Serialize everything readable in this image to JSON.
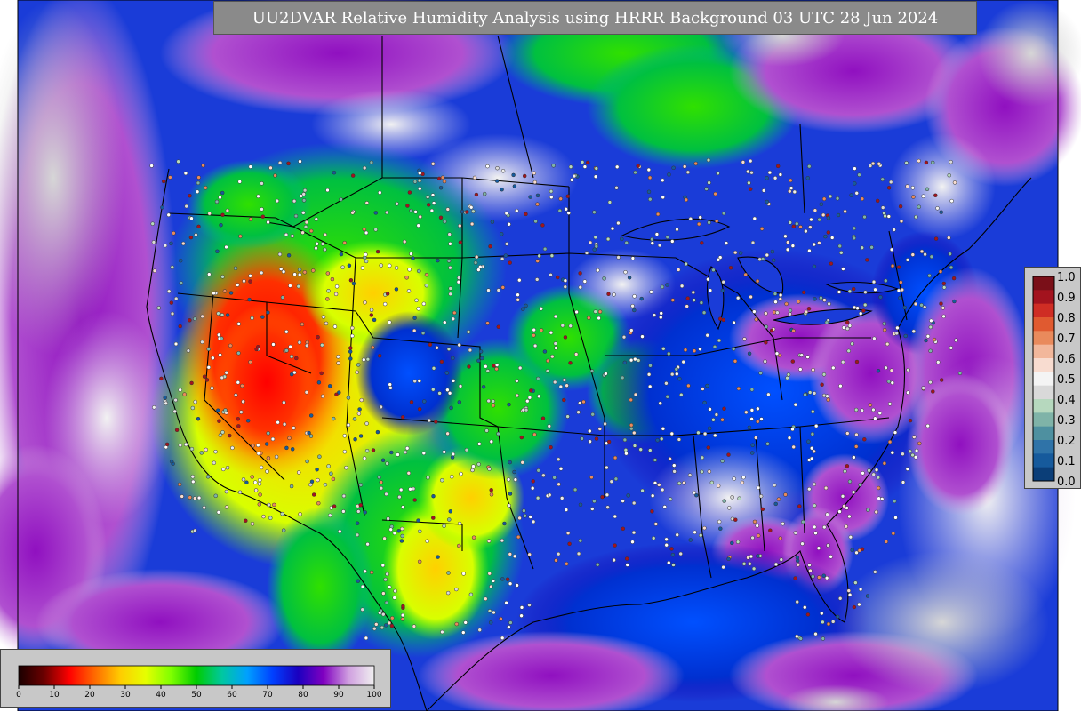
{
  "title": "UU2DVAR Relative Humidity Analysis using HRRR Background 03 UTC 28 Jun 2024",
  "rh_colorbar": {
    "ticks": [
      "0",
      "10",
      "20",
      "30",
      "40",
      "50",
      "60",
      "70",
      "80",
      "90",
      "100"
    ],
    "stops": [
      "#1a0000",
      "#6b0000",
      "#ff0000",
      "#ff6a00",
      "#ffcc00",
      "#e6ff00",
      "#7fff00",
      "#00cc00",
      "#00c8a0",
      "#00a0ff",
      "#0040ff",
      "#1a00c0",
      "#8000c0",
      "#d0a0e0",
      "#f0f0f0"
    ]
  },
  "increment_colorbar": {
    "ticks": [
      "1.0",
      "0.9",
      "0.8",
      "0.7",
      "0.6",
      "0.5",
      "0.4",
      "0.3",
      "0.2",
      "0.1",
      "0.0"
    ],
    "colors": [
      "#7a0f18",
      "#a3131e",
      "#cf2d24",
      "#e05a30",
      "#e98a5c",
      "#f2b79b",
      "#f8dcd0",
      "#f4f4f4",
      "#d9d9d9",
      "#b6d8be",
      "#7fb3a8",
      "#4e90a0",
      "#2f73a8",
      "#165a9c",
      "#0b3e78"
    ]
  },
  "colors": {
    "land_gray": "#c8c8c8",
    "title_bg": "#8a8a8a"
  }
}
